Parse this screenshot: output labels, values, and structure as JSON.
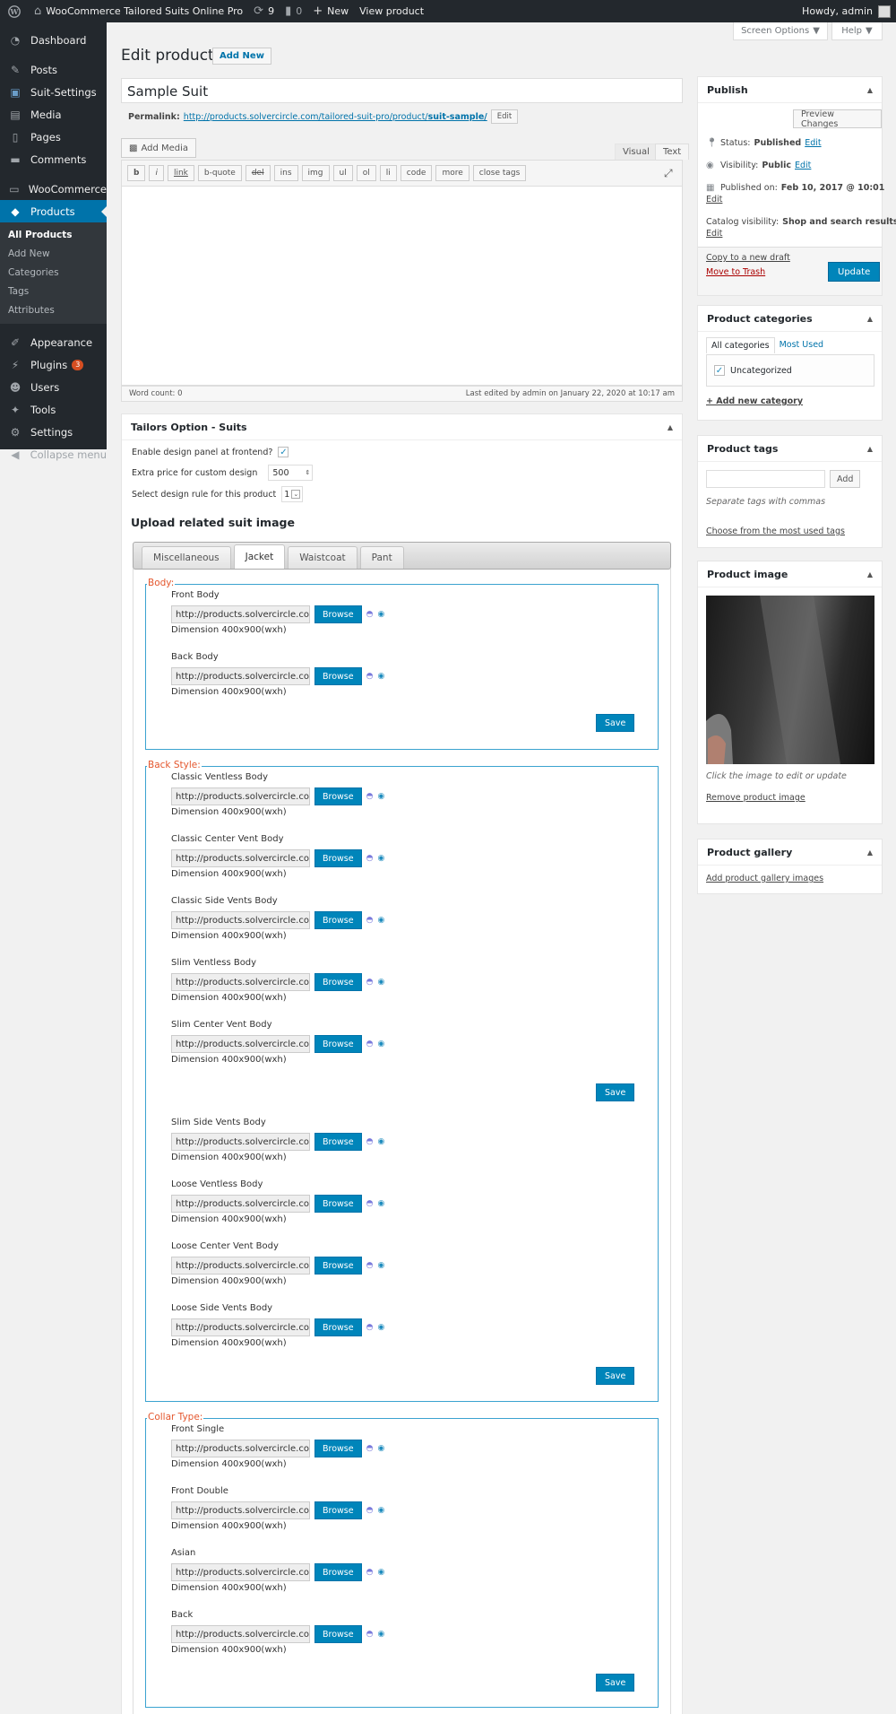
{
  "adminbar": {
    "site_name": "WooCommerce Tailored Suits Online Pro",
    "updates": "9",
    "comments": "0",
    "new_label": "New",
    "view_product": "View product",
    "howdy": "Howdy, admin"
  },
  "top_buttons": {
    "screen_options": "Screen Options",
    "help": "Help"
  },
  "sidebar": {
    "items": [
      {
        "label": "Dashboard",
        "icon": "dashboard-icon"
      },
      {
        "label": "Posts",
        "icon": "pin-icon"
      },
      {
        "label": "Suit-Settings",
        "icon": "suit-icon"
      },
      {
        "label": "Media",
        "icon": "media-icon"
      },
      {
        "label": "Pages",
        "icon": "page-icon"
      },
      {
        "label": "Comments",
        "icon": "comment-icon"
      },
      {
        "label": "WooCommerce",
        "icon": "woo-icon"
      },
      {
        "label": "Products",
        "icon": "products-icon"
      },
      {
        "label": "Appearance",
        "icon": "brush-icon"
      },
      {
        "label": "Plugins",
        "icon": "plugin-icon",
        "badge": "3"
      },
      {
        "label": "Users",
        "icon": "users-icon"
      },
      {
        "label": "Tools",
        "icon": "wrench-icon"
      },
      {
        "label": "Settings",
        "icon": "settings-icon"
      },
      {
        "label": "Collapse menu",
        "icon": "collapse-icon"
      }
    ],
    "products_sub": [
      "All Products",
      "Add New",
      "Categories",
      "Tags",
      "Attributes"
    ]
  },
  "page": {
    "title": "Edit product",
    "add_new": "Add New"
  },
  "post": {
    "title": "Sample Suit",
    "permalink_label": "Permalink:",
    "permalink_base": "http://products.solvercircle.com/tailored-suit-pro/product/",
    "permalink_slug": "suit-sample/",
    "edit": "Edit"
  },
  "editor": {
    "add_media": "Add Media",
    "tab_visual": "Visual",
    "tab_text": "Text",
    "buttons": [
      "b",
      "i",
      "link",
      "b-quote",
      "del",
      "ins",
      "img",
      "ul",
      "ol",
      "li",
      "code",
      "more",
      "close tags"
    ],
    "word_count": "Word count: 0",
    "last_edited": "Last edited by admin on January 22, 2020 at 10:17 am"
  },
  "tailors": {
    "title": "Tailors Option - Suits",
    "enable_label": "Enable design panel at frontend?",
    "extra_price_label": "Extra price for custom design",
    "extra_price_value": "500",
    "rule_label": "Select design rule for this product",
    "rule_value": "1",
    "upload_title": "Upload related suit image",
    "tabs": [
      "Miscellaneous",
      "Jacket",
      "Waistcoat",
      "Pant"
    ],
    "url_value": "http://products.solvercircle.com/",
    "browse": "Browse",
    "dimension": "Dimension 400x900(wxh)",
    "save": "Save",
    "groups": [
      {
        "legend": "Body:",
        "items": [
          "Front Body",
          "Back Body"
        ]
      },
      {
        "legend": "Back Style:",
        "items": [
          "Classic Ventless Body",
          "Classic Center Vent Body",
          "Classic Side Vents Body",
          "Slim Ventless Body",
          "Slim Center Vent Body",
          "Slim Side Vents Body",
          "Loose Ventless Body",
          "Loose Center Vent Body",
          "Loose Side Vents Body"
        ]
      },
      {
        "legend": "Collar Type:",
        "items": [
          "Front Single",
          "Front Double",
          "Asian",
          "Back"
        ]
      }
    ]
  },
  "publish": {
    "title": "Publish",
    "preview": "Preview Changes",
    "status_label": "Status:",
    "status_value": "Published",
    "visibility_label": "Visibility:",
    "visibility_value": "Public",
    "published_label": "Published on:",
    "published_value": "Feb 10, 2017 @ 10:01",
    "catalog_label": "Catalog visibility:",
    "catalog_value": "Shop and search results",
    "edit": "Edit",
    "copy": "Copy to a new draft",
    "trash": "Move to Trash",
    "update": "Update"
  },
  "categories": {
    "title": "Product categories",
    "tab_all": "All categories",
    "tab_most": "Most Used",
    "item": "Uncategorized",
    "add_new": "+ Add new category"
  },
  "tags": {
    "title": "Product tags",
    "add": "Add",
    "hint": "Separate tags with commas",
    "choose": "Choose from the most used tags"
  },
  "product_image": {
    "title": "Product image",
    "hint": "Click the image to edit or update",
    "remove": "Remove product image"
  },
  "gallery": {
    "title": "Product gallery",
    "add": "Add product gallery images"
  }
}
